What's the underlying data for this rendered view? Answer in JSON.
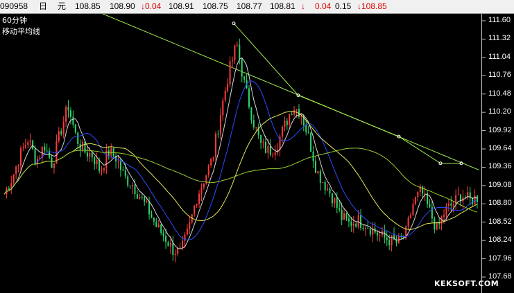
{
  "quote_bar": {
    "code": "090958",
    "unit_day": "日",
    "currency": "元",
    "open": "108.85",
    "high": "108.90",
    "change_down": "↓0.04",
    "v1": "108.91",
    "v2": "108.75",
    "v3": "108.77",
    "last": "108.81",
    "arrow": "↓",
    "change": "0.04",
    "change_pct": "0.15",
    "last_down": "↓108.85"
  },
  "chart_labels": {
    "period": "60分钟",
    "indicator": "移动平均线"
  },
  "watermark": "KEKSOFT.COM",
  "colors": {
    "background": "#000000",
    "up_candle": "#ff3b3b",
    "down_candle": "#2fd66b",
    "ma_blue": "#2b4cff",
    "ma_yellow": "#e8e85a",
    "ma_white": "#d8d8d8",
    "ma_green": "#9acd32",
    "trendline": "#a8f050"
  },
  "chart_data": {
    "type": "line",
    "yaxis": {
      "ticks": [
        "111.60",
        "111.32",
        "111.04",
        "110.76",
        "110.48",
        "110.20",
        "109.92",
        "109.64",
        "109.36",
        "109.08",
        "108.80",
        "108.52",
        "108.24",
        "107.96",
        "107.68"
      ],
      "ylim": [
        107.68,
        111.6
      ]
    },
    "series": [
      {
        "values": [
          108.95,
          109.2,
          109.55,
          109.8,
          109.45,
          109.7,
          109.4,
          109.9,
          110.3,
          109.8,
          109.6,
          109.55,
          109.3,
          109.6,
          109.5,
          109.2,
          109.1,
          108.9,
          108.7,
          108.45,
          108.3,
          108.1,
          108.05,
          108.4,
          108.9,
          109.2,
          109.5,
          110.2,
          110.8,
          111.25,
          110.6,
          110.1,
          109.7,
          109.6,
          109.7,
          110.0,
          110.3,
          110.2,
          109.8,
          109.3,
          109.1,
          108.9,
          108.6,
          108.5,
          108.55,
          108.5,
          108.4,
          108.3,
          108.25,
          108.2,
          108.3,
          108.8,
          109.0,
          108.7,
          108.4,
          108.7,
          108.8,
          108.95,
          108.85,
          108.9
        ]
      }
    ]
  }
}
